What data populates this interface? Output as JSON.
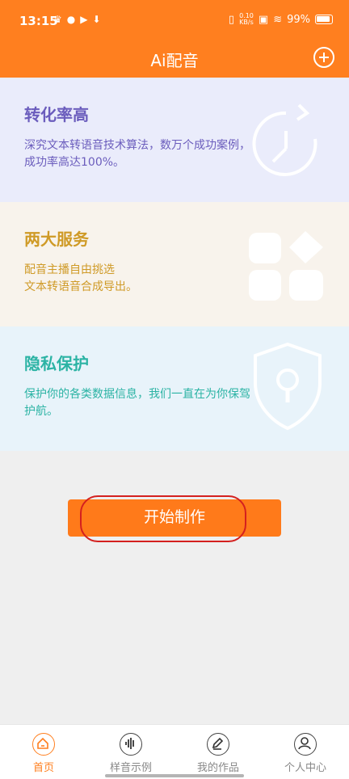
{
  "status_bar": {
    "time": "13:15",
    "net_speed_value": "0.10",
    "net_speed_unit": "KB/s",
    "battery": "99%"
  },
  "header": {
    "title": "Ai配音"
  },
  "cards": [
    {
      "title": "转化率高",
      "desc": "深究文本转语音技术算法，数万个成功案例，成功率高达100%。",
      "icon": "clock-refresh-icon"
    },
    {
      "title": "两大服务",
      "desc_line1": "配音主播自由挑选",
      "desc_line2": "文本转语音合成导出。",
      "icon": "grid-icon"
    },
    {
      "title": "隐私保护",
      "desc": "保护你的各类数据信息，我们一直在为你保驾护航。",
      "icon": "shield-lock-icon"
    }
  ],
  "start_button": {
    "label": "开始制作"
  },
  "tabs": [
    {
      "label": "首页",
      "icon": "home-icon",
      "active": true
    },
    {
      "label": "样音示例",
      "icon": "waveform-icon",
      "active": false
    },
    {
      "label": "我的作品",
      "icon": "pencil-icon",
      "active": false
    },
    {
      "label": "个人中心",
      "icon": "user-icon",
      "active": false
    }
  ],
  "colors": {
    "accent": "#ff7f1f",
    "card1_text": "#6b5dbd",
    "card2_text": "#cf9a26",
    "card3_text": "#2bb3a4",
    "highlight": "#d4201f"
  }
}
